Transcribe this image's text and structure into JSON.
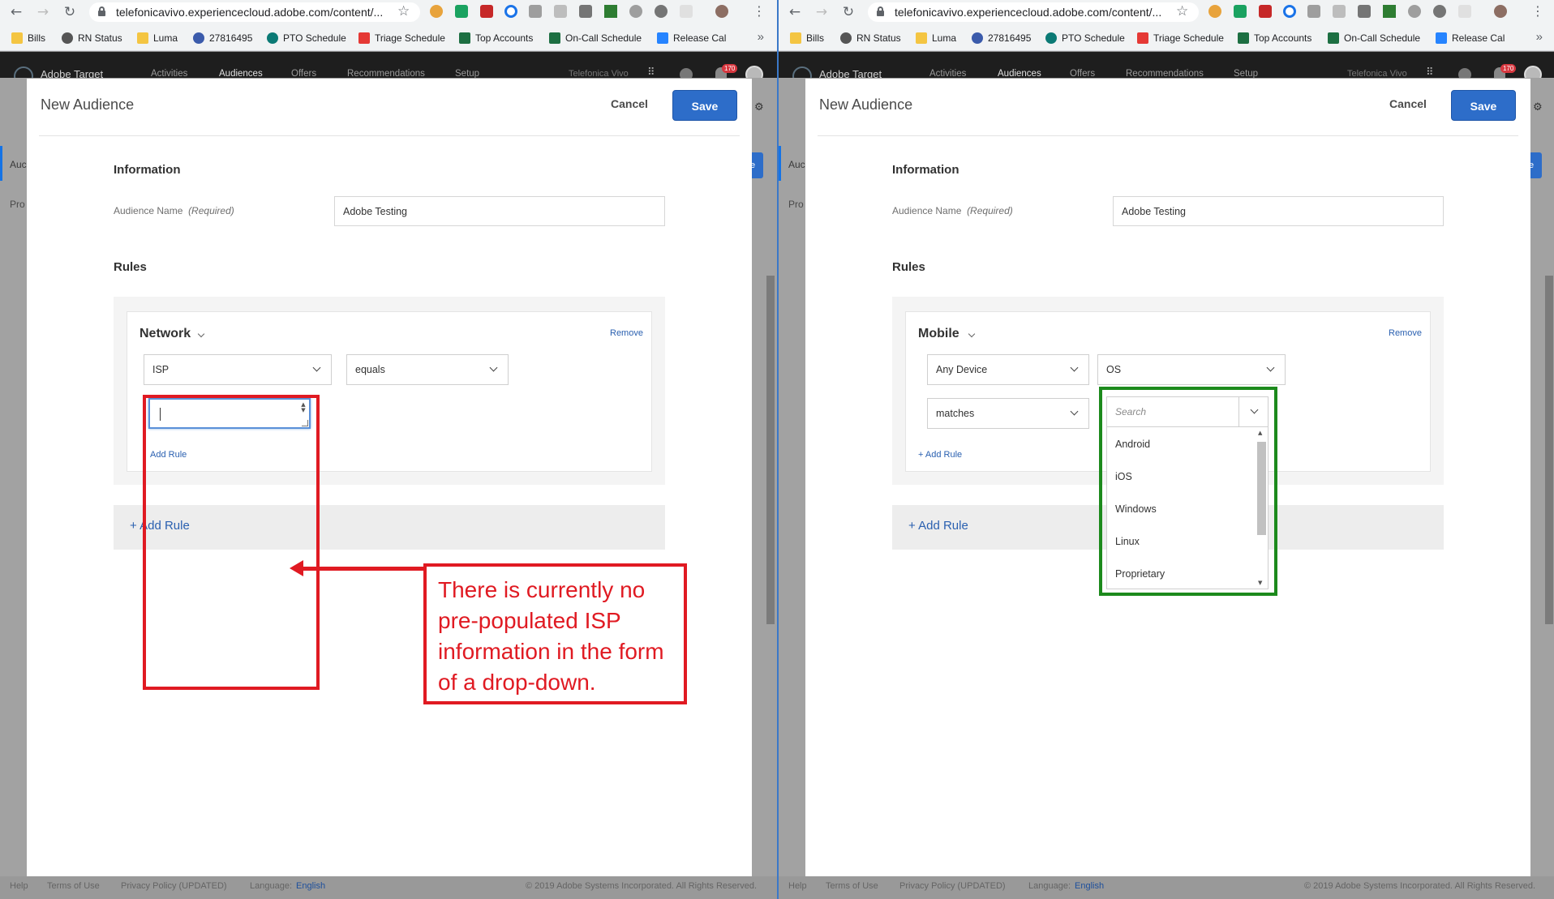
{
  "browser": {
    "url": "telefonicavivo.experiencecloud.adobe.com/content/...",
    "bookmarks": [
      "Bills",
      "RN Status",
      "Luma",
      "27816495",
      "PTO Schedule",
      "Triage Schedule",
      "Top Accounts",
      "On-Call Schedule",
      "Release Cal"
    ],
    "more": "»"
  },
  "app": {
    "brand": "Adobe Target",
    "nav": [
      "Activities",
      "Audiences",
      "Offers",
      "Recommendations",
      "Setup"
    ],
    "org": "Telefonica Vivo",
    "notif_count": "170"
  },
  "background": {
    "side_label": "Auc",
    "side_label2": "Pro",
    "btn_text": "e"
  },
  "footer": {
    "help": "Help",
    "terms": "Terms of Use",
    "privacy": "Privacy Policy (UPDATED)",
    "language_label": "Language:",
    "language": "English",
    "copyright": "© 2019 Adobe Systems Incorporated. All Rights Reserved."
  },
  "modal": {
    "title": "New Audience",
    "cancel": "Cancel",
    "save": "Save",
    "info_heading": "Information",
    "name_label": "Audience Name",
    "name_required": "(Required)",
    "name_value": "Adobe Testing",
    "rules_heading": "Rules",
    "remove": "Remove",
    "add_rule_small": "Add Rule",
    "add_rule_small_right": "+ Add Rule",
    "add_rule": "+ Add Rule"
  },
  "left": {
    "rule_title": "Network",
    "attribute": "ISP",
    "operator": "equals",
    "callout": "There is currently no pre-populated ISP information in the form of a drop-down."
  },
  "right": {
    "rule_title": "Mobile",
    "device": "Any Device",
    "attribute": "OS",
    "operator": "matches",
    "search_placeholder": "Search",
    "options": [
      "Android",
      "iOS",
      "Windows",
      "Linux",
      "Proprietary"
    ]
  },
  "colors": {
    "annotation_red": "#e01a22",
    "annotation_green": "#1c8a1c",
    "primary_blue": "#2d6dc9"
  }
}
